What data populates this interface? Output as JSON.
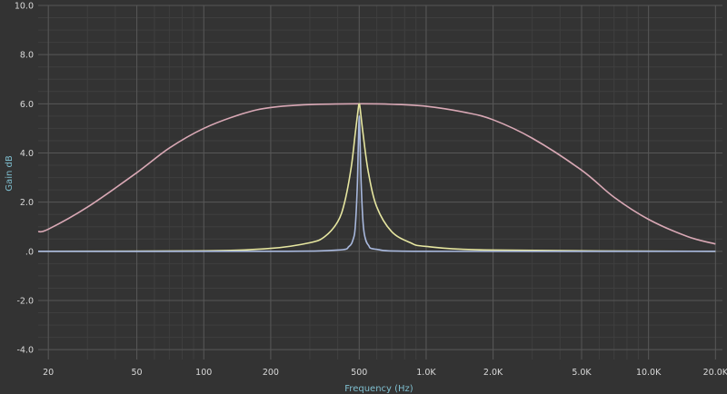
{
  "chart_data": {
    "type": "line",
    "title": "",
    "xlabel": "Frequency (Hz)",
    "ylabel": "Gain dB",
    "xscale": "log",
    "xlim": [
      18,
      21500
    ],
    "ylim": [
      -4.4,
      10.0
    ],
    "grid": true,
    "legend": "none",
    "x_ticks": [
      {
        "value": 20,
        "label": "20"
      },
      {
        "value": 50,
        "label": "50"
      },
      {
        "value": 100,
        "label": "100"
      },
      {
        "value": 200,
        "label": "200"
      },
      {
        "value": 500,
        "label": "500"
      },
      {
        "value": 1000,
        "label": "1.0K"
      },
      {
        "value": 2000,
        "label": "2.0K"
      },
      {
        "value": 5000,
        "label": "5.0K"
      },
      {
        "value": 10000,
        "label": "10.0K"
      },
      {
        "value": 20000,
        "label": "20.0K"
      }
    ],
    "y_ticks": [
      {
        "value": 10,
        "label": "10.0"
      },
      {
        "value": 8,
        "label": "8.0"
      },
      {
        "value": 6,
        "label": "6.0"
      },
      {
        "value": 4,
        "label": "4.0"
      },
      {
        "value": 2,
        "label": "2.0"
      },
      {
        "value": 0,
        "label": ".0"
      },
      {
        "value": -2,
        "label": "-2.0"
      },
      {
        "value": -4,
        "label": "-4.0"
      }
    ],
    "series": [
      {
        "color": "#d9a8b5",
        "x": [
          18,
          20,
          30,
          50,
          70,
          100,
          150,
          200,
          300,
          500,
          700,
          1000,
          1500,
          2000,
          3000,
          5000,
          7000,
          10000,
          15000,
          20000
        ],
        "y": [
          0.8,
          0.9,
          1.8,
          3.2,
          4.2,
          5.0,
          5.6,
          5.85,
          5.97,
          6.0,
          5.98,
          5.9,
          5.65,
          5.35,
          4.6,
          3.3,
          2.2,
          1.3,
          0.6,
          0.3
        ]
      },
      {
        "color": "#e6e6a0",
        "x": [
          18,
          100,
          200,
          300,
          350,
          400,
          430,
          460,
          480,
          495,
          500,
          505,
          520,
          550,
          600,
          700,
          850,
          1000,
          2000,
          20000
        ],
        "y": [
          0.0,
          0.02,
          0.12,
          0.35,
          0.6,
          1.2,
          2.0,
          3.4,
          4.8,
          5.8,
          6.0,
          5.8,
          4.8,
          3.2,
          1.8,
          0.8,
          0.35,
          0.2,
          0.05,
          0.0
        ]
      },
      {
        "color": "#a8b8dd",
        "x": [
          18,
          200,
          400,
          450,
          470,
          480,
          490,
          495,
          500,
          505,
          510,
          520,
          530,
          550,
          600,
          1000,
          20000
        ],
        "y": [
          0.0,
          0.0,
          0.05,
          0.2,
          0.5,
          1.0,
          2.6,
          4.2,
          5.5,
          4.3,
          2.8,
          1.2,
          0.6,
          0.25,
          0.08,
          0.0,
          0.0
        ]
      }
    ]
  }
}
